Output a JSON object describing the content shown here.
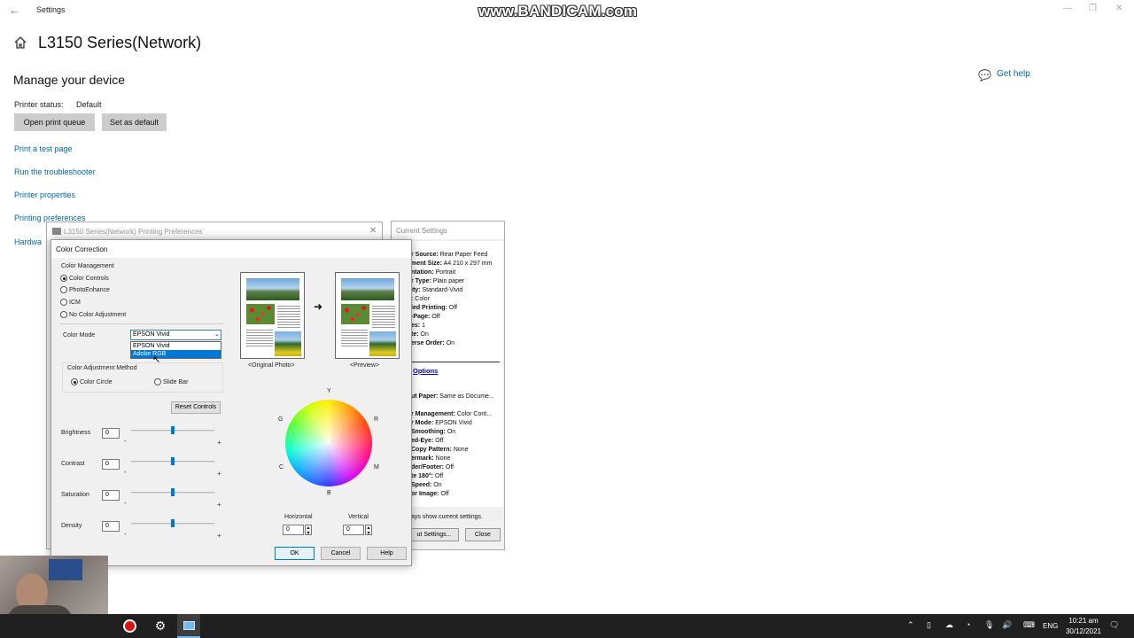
{
  "settings": {
    "app_title": "Settings",
    "device_title": "L3150 Series(Network)",
    "manage_heading": "Manage your device",
    "get_help": "Get help",
    "printer_status_label": "Printer status:",
    "printer_status_value": "Default",
    "open_queue_button": "Open print queue",
    "set_default_button": "Set as default",
    "links": [
      "Print a test page",
      "Run the troubleshooter",
      "Printer properties",
      "Printing preferences"
    ],
    "hardware_link": "Hardwa"
  },
  "watermark": "www.BANDICAM.com",
  "prefs_window": {
    "title": "L3150 Series(Network) Printing Preferences"
  },
  "current_settings": {
    "title": "Current Settings",
    "lines": [
      {
        "k": "r Source:",
        "v": "Rear Paper Feed"
      },
      {
        "k": "ment Size:",
        "v": "A4 210 x 297 mm"
      },
      {
        "k": "ntation:",
        "v": "Portrait"
      },
      {
        "k": "r Type:",
        "v": "Plain paper"
      },
      {
        "k": "ity:",
        "v": "Standard-Vivid"
      },
      {
        "k": ":",
        "v": "Color"
      },
      {
        "k": "led Printing:",
        "v": "Off"
      },
      {
        "k": "-Page:",
        "v": "Off"
      },
      {
        "k": "es:",
        "v": "1"
      },
      {
        "k": "te:",
        "v": "On"
      },
      {
        "k": "erse Order:",
        "v": "On"
      }
    ],
    "options_link": "Options",
    "options_lines": [
      {
        "k": "ut Paper:",
        "v": "Same as Docume..."
      },
      {
        "k": "r Management:",
        "v": "Color Cont..."
      },
      {
        "k": "r Mode:",
        "v": "EPSON Vivid"
      },
      {
        "k": "Smoothing:",
        "v": "On"
      },
      {
        "k": "ed-Eye:",
        "v": "Off"
      },
      {
        "k": "Copy Pattern:",
        "v": "None"
      },
      {
        "k": "ermark:",
        "v": "None"
      },
      {
        "k": "der/Footer:",
        "v": "Off"
      },
      {
        "k": "te 180°:",
        "v": "Off"
      },
      {
        "k": "Speed:",
        "v": "On"
      },
      {
        "k": "or Image:",
        "v": "Off"
      }
    ],
    "footer_text": "ays show current settings.",
    "about_button": "ut Settings...",
    "close_button": "Close"
  },
  "color_correction": {
    "title": "Color Correction",
    "color_management_label": "Color Management",
    "management_options": [
      {
        "label": "Color Controls",
        "selected": true
      },
      {
        "label": "PhotoEnhance",
        "selected": false
      },
      {
        "label": "ICM",
        "selected": false
      },
      {
        "label": "No Color Adjustment",
        "selected": false
      }
    ],
    "color_mode_label": "Color Mode",
    "color_mode_value": "EPSON Vivid",
    "color_mode_options": [
      "EPSON Vivid",
      "Adobe RGB"
    ],
    "color_mode_highlighted": "Adobe RGB",
    "adjustment_method_label": "Color Adjustment Method",
    "adjustment_methods": [
      {
        "label": "Color Circle",
        "selected": true
      },
      {
        "label": "Slide Bar",
        "selected": false
      }
    ],
    "reset_button": "Reset Controls",
    "sliders": [
      {
        "label": "Brightness",
        "value": "0"
      },
      {
        "label": "Contrast",
        "value": "0"
      },
      {
        "label": "Saturation",
        "value": "0"
      },
      {
        "label": "Density",
        "value": "0"
      }
    ],
    "original_caption": "<Original Photo>",
    "preview_caption": "<Preview>",
    "wheel_labels": {
      "top": "Y",
      "left_top": "G",
      "right_top": "R",
      "left_bottom": "C",
      "right_bottom": "M",
      "bottom": "B"
    },
    "horizontal_label": "Horizontal",
    "horizontal_value": "0",
    "vertical_label": "Vertical",
    "vertical_value": "0",
    "ok_button": "OK",
    "cancel_button": "Cancel",
    "help_button": "Help"
  },
  "taskbar": {
    "language": "ENG",
    "time": "10:21 am",
    "date": "30/12/2021"
  }
}
